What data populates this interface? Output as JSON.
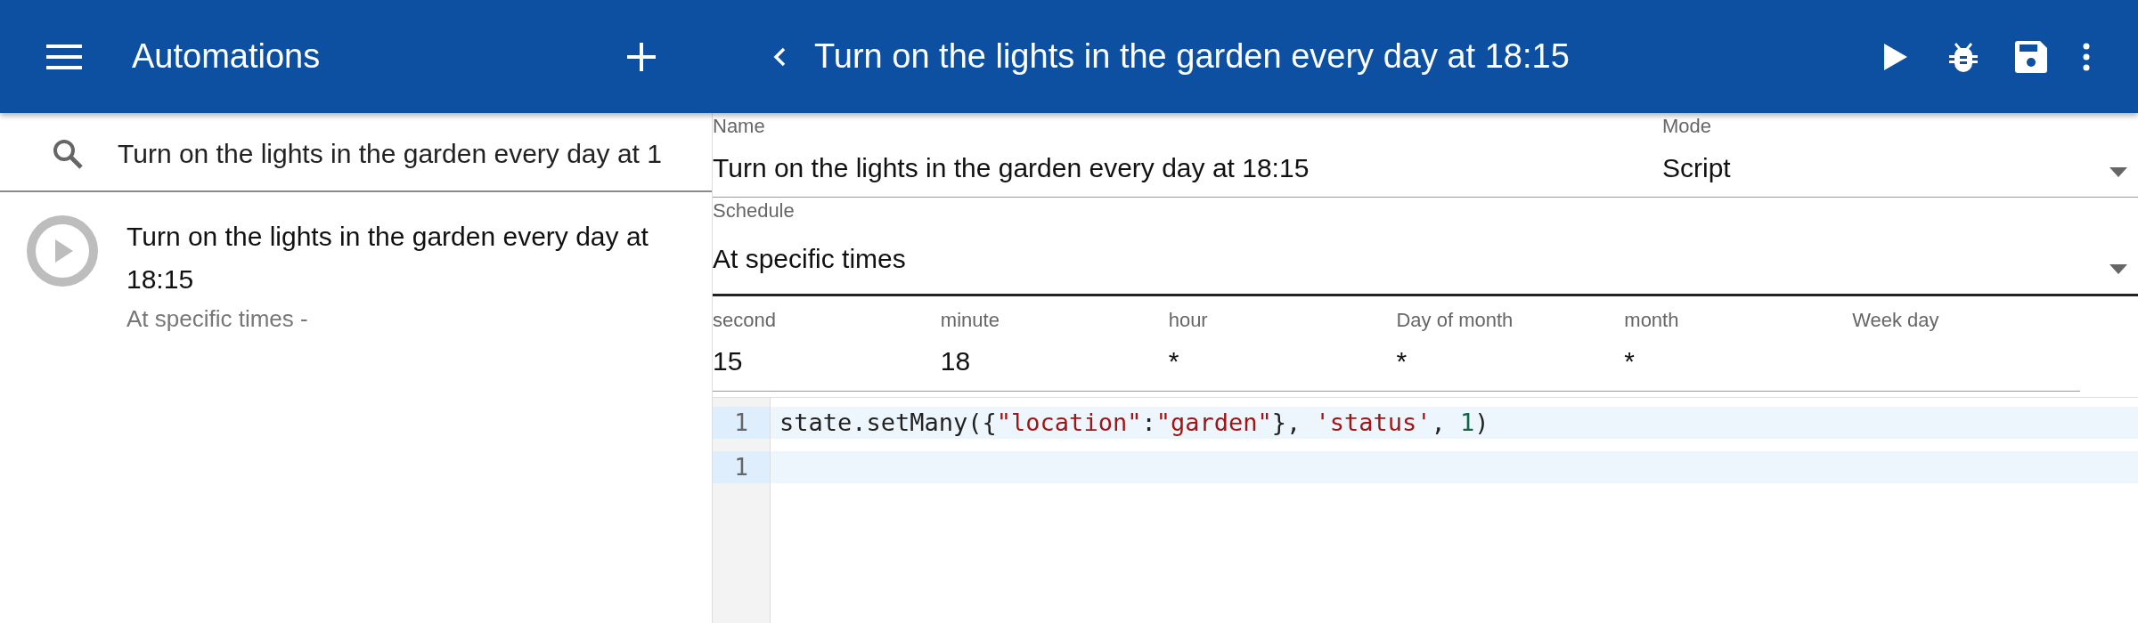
{
  "sidebar": {
    "title": "Automations",
    "search": {
      "value": "Turn on the lights in the garden every day at 1"
    },
    "items": [
      {
        "title": "Turn on the lights in the garden every day at 18:15",
        "subtitle": "At specific times -"
      }
    ]
  },
  "editor": {
    "title": "Turn on the lights in the garden every day at 18:15",
    "name": {
      "label": "Name",
      "value": "Turn on the lights in the garden every day at 18:15"
    },
    "mode": {
      "label": "Mode",
      "value": "Script"
    },
    "schedule": {
      "label": "Schedule",
      "value": "At specific times"
    },
    "cron": [
      {
        "label": "second",
        "value": "15"
      },
      {
        "label": "minute",
        "value": "18"
      },
      {
        "label": "hour",
        "value": "*"
      },
      {
        "label": "Day of month",
        "value": "*"
      },
      {
        "label": "month",
        "value": "*"
      },
      {
        "label": "Week day"
      }
    ],
    "code": [
      {
        "number": "1",
        "tokens": [
          {
            "kind": "plain",
            "text": "state.setMany({"
          },
          {
            "kind": "string",
            "text": "\"location\""
          },
          {
            "kind": "plain",
            "text": ":"
          },
          {
            "kind": "string",
            "text": "\"garden\""
          },
          {
            "kind": "plain",
            "text": "}, "
          },
          {
            "kind": "string",
            "text": "'status'"
          },
          {
            "kind": "plain",
            "text": ", "
          },
          {
            "kind": "number",
            "text": "1"
          },
          {
            "kind": "plain",
            "text": ")"
          }
        ]
      },
      {
        "number": "1"
      }
    ]
  }
}
